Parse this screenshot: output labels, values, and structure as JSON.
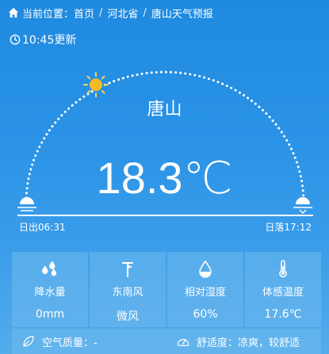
{
  "breadcrumb": {
    "prefix": "当前位置：",
    "items": [
      "首页",
      "河北省",
      "唐山天气预报"
    ],
    "separator": "/"
  },
  "update_time": "10:45更新",
  "city": "唐山",
  "temperature": "18.3℃",
  "sun": {
    "sunrise": "日出06:31",
    "sunset": "日落17:12"
  },
  "stats": [
    {
      "icon": "rain-drops-icon",
      "label": "降水量",
      "value": "0mm"
    },
    {
      "icon": "wind-vane-icon",
      "label": "东南风",
      "value": "微风"
    },
    {
      "icon": "humidity-drop-icon",
      "label": "相对湿度",
      "value": "60%"
    },
    {
      "icon": "thermometer-icon",
      "label": "体感温度",
      "value": "17.6℃"
    }
  ],
  "bottom": {
    "air_quality": "空气质量：-",
    "comfort": "舒适度：凉爽，较舒适"
  }
}
